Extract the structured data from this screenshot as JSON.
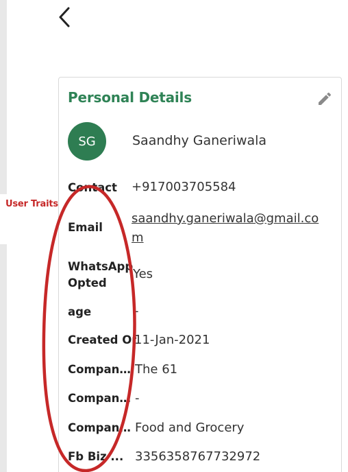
{
  "annotation": {
    "label": "User Traits",
    "color": "#c62828"
  },
  "nav": {
    "back_icon": "chevron-left-icon"
  },
  "card": {
    "title": "Personal Details",
    "edit_icon": "pencil-icon",
    "title_color": "#2f8356"
  },
  "profile": {
    "initials": "SG",
    "name": "Saandhy Ganeriwala",
    "avatar_color": "#2e7d52"
  },
  "fields": {
    "contact": {
      "label": "Contact",
      "value": "+917003705584"
    },
    "email": {
      "label": "Email",
      "value": "saandhy.ganeriwala@gmail.com"
    },
    "whatsapp": {
      "label": "WhatsApp Opted",
      "value": "Yes"
    },
    "age": {
      "label": "age",
      "value": "-"
    },
    "created_on": {
      "label": "Created On",
      "value": "11-Jan-2021"
    },
    "company_1": {
      "label": "Company...",
      "value": "The 61"
    },
    "company_2": {
      "label": "Company...",
      "value": "-"
    },
    "company_3": {
      "label": "Company...",
      "value": "Food and Grocery"
    },
    "fb_biz": {
      "label": "Fb Biz ...",
      "value": "3356358767732972"
    }
  }
}
